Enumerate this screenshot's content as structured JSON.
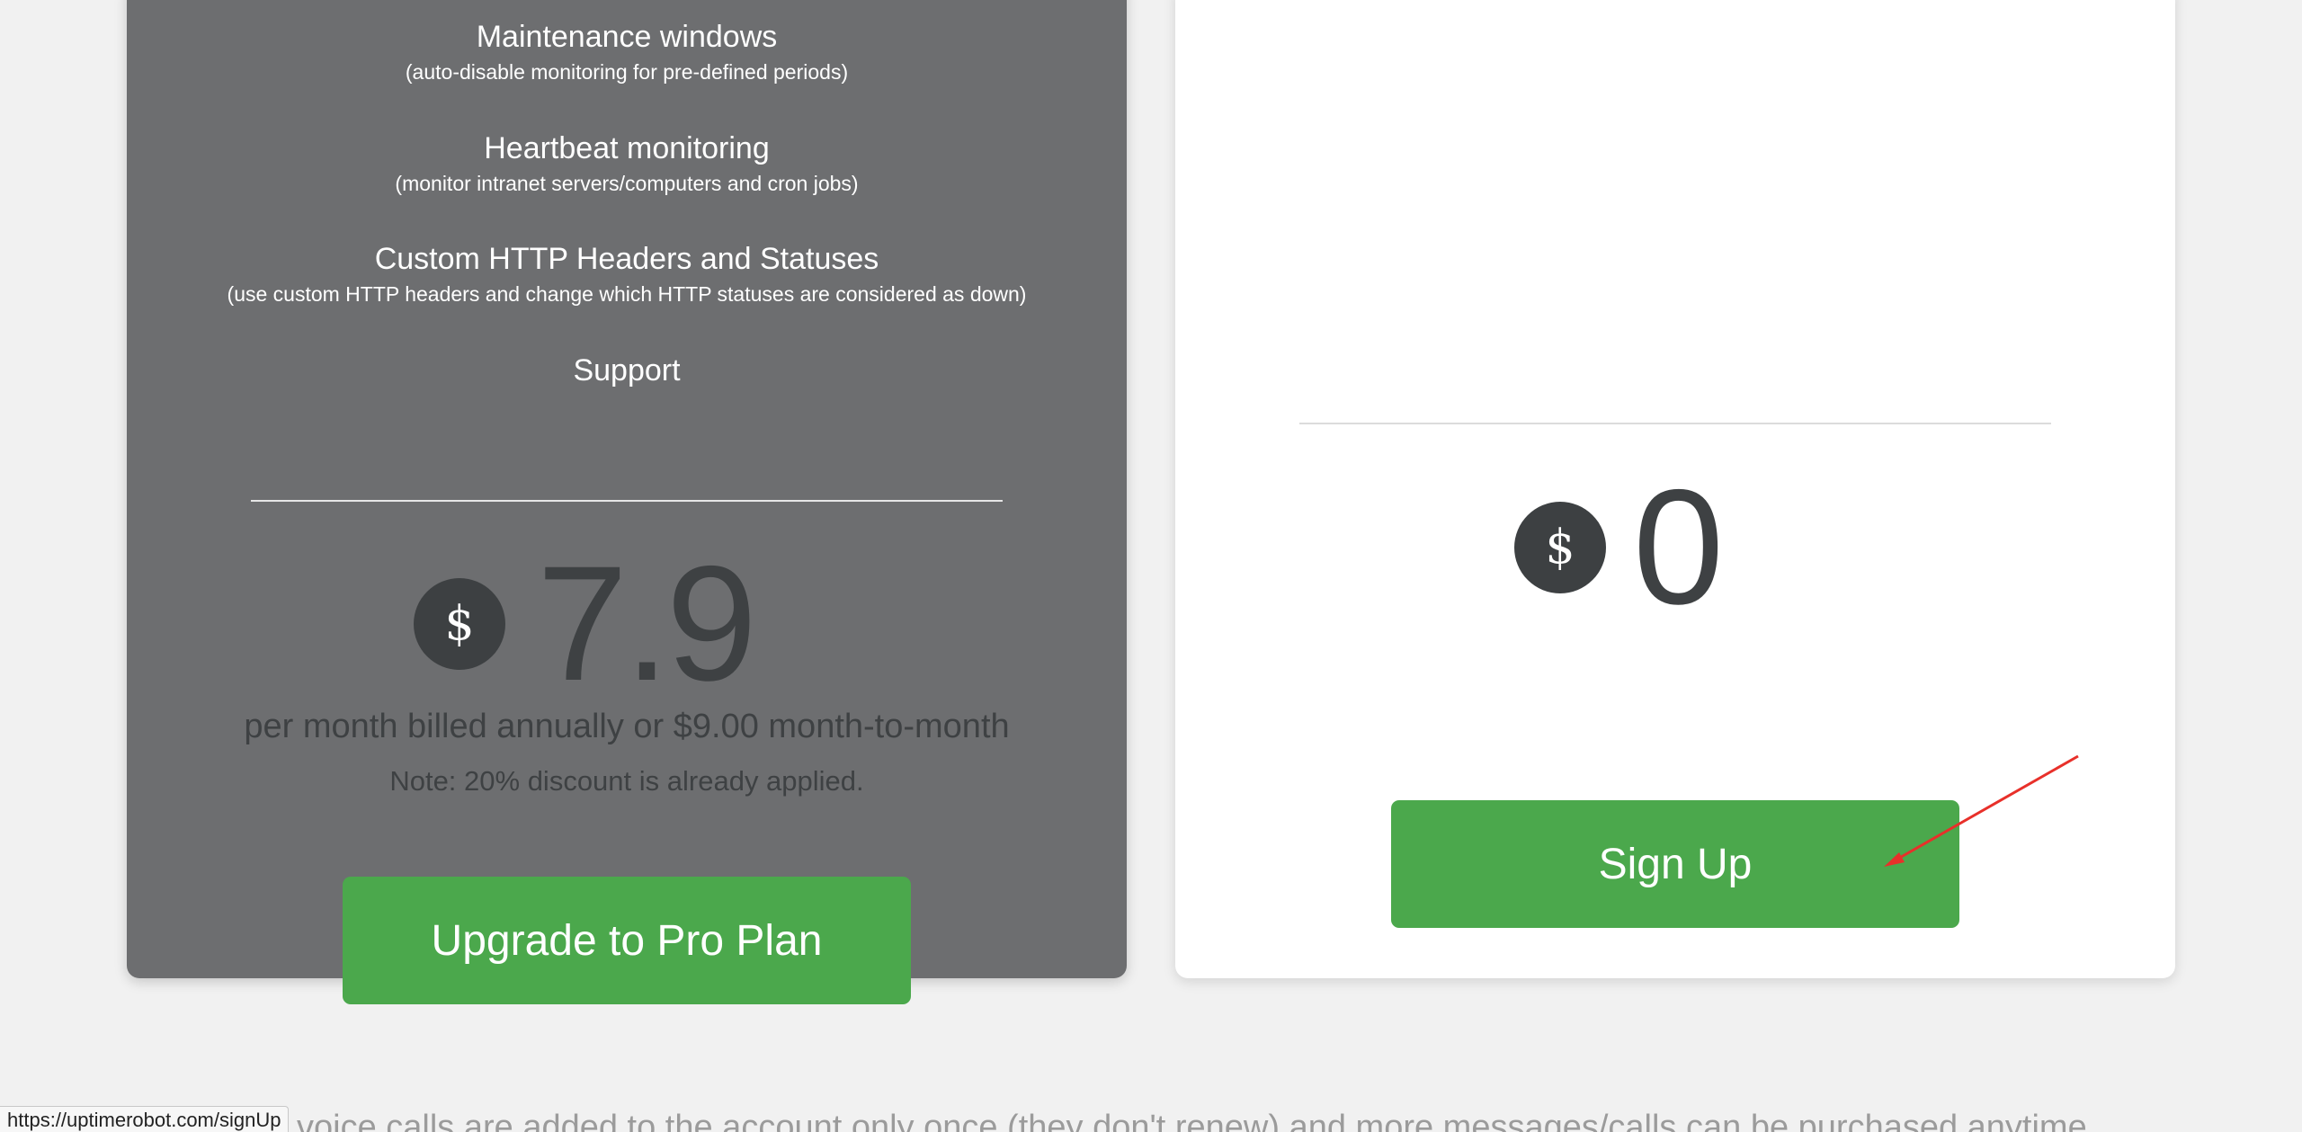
{
  "pro_plan": {
    "features": [
      {
        "title": "Maintenance windows",
        "desc": "(auto-disable monitoring for pre-defined periods)"
      },
      {
        "title": "Heartbeat monitoring",
        "desc": "(monitor intranet servers/computers and cron jobs)"
      },
      {
        "title": "Custom HTTP Headers and Statuses",
        "desc": "(use custom HTTP headers and change which HTTP statuses are considered as down)"
      },
      {
        "title": "Support",
        "desc": ""
      }
    ],
    "currency_symbol": "$",
    "price": "7.9",
    "billing": "per month billed annually or $9.00 month-to-month",
    "note": "Note: 20% discount is already applied.",
    "button_label": "Upgrade to Pro Plan"
  },
  "free_plan": {
    "currency_symbol": "$",
    "price": "0",
    "button_label": "Sign Up"
  },
  "footer_text": "voice calls are added to the account only once (they don't renew) and more messages/calls can be purchased anytime.",
  "status_bar_url": "https://uptimerobot.com/signUp",
  "colors": {
    "pro_card_bg": "#6d6e70",
    "free_card_bg": "#ffffff",
    "button_green": "#4ba84c",
    "price_dark": "#3e4143",
    "annotation_arrow": "#e8302a"
  }
}
